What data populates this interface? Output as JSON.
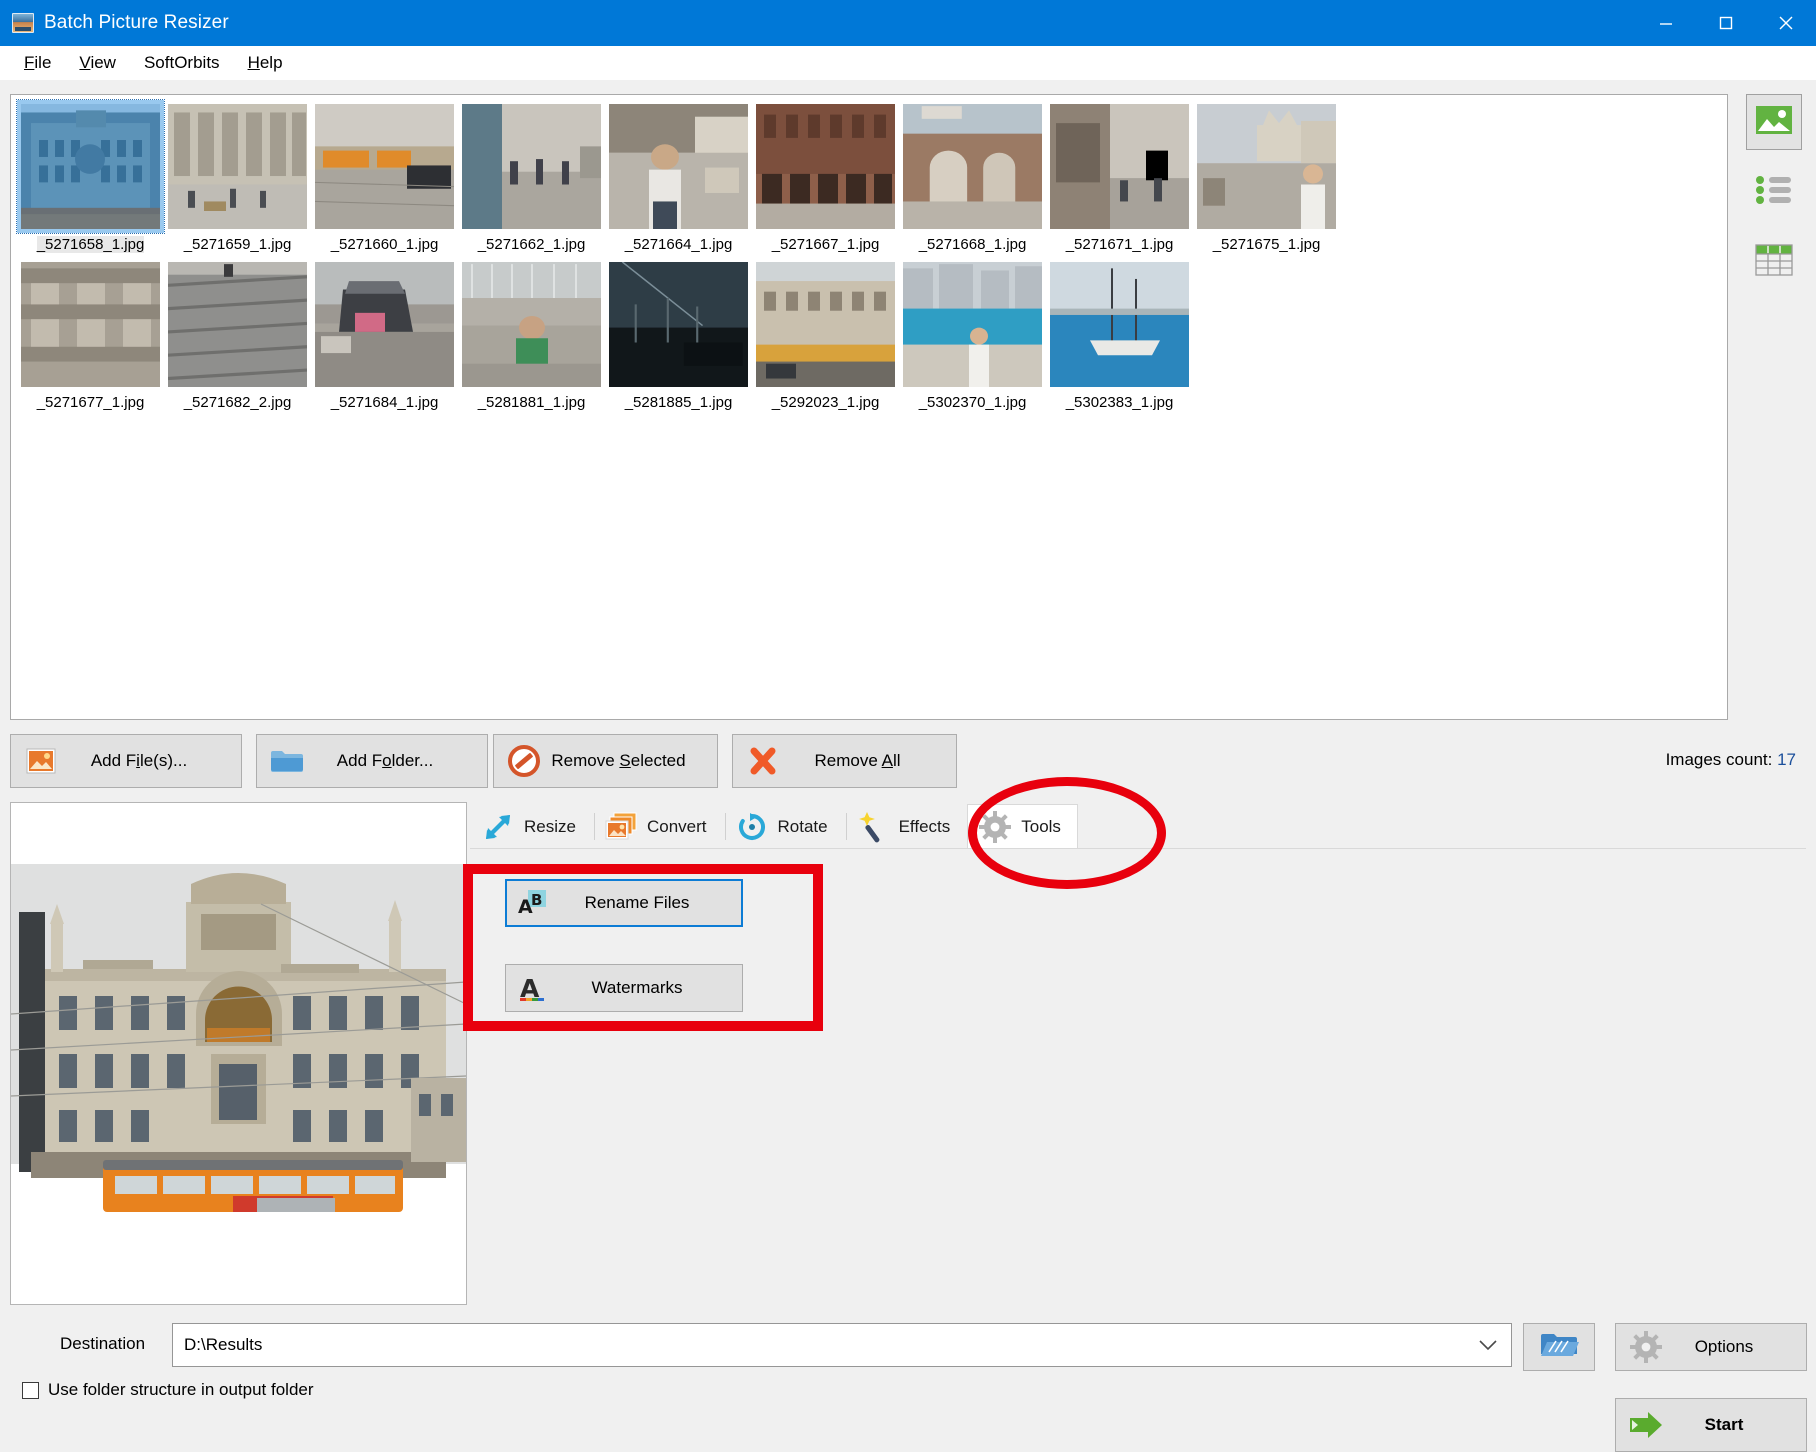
{
  "window": {
    "title": "Batch Picture Resizer",
    "app_icon": "picture-frame-icon",
    "controls": {
      "minimize": "minimize-icon",
      "maximize": "maximize-icon",
      "close": "close-icon"
    }
  },
  "menubar": {
    "items": [
      {
        "label": "File",
        "accel": "F"
      },
      {
        "label": "View",
        "accel": "V"
      },
      {
        "label": "SoftOrbits",
        "accel": ""
      },
      {
        "label": "Help",
        "accel": "H"
      }
    ]
  },
  "filelist": {
    "selected_index": 0,
    "rows": [
      [
        {
          "label": "_5271658_1.jpg",
          "kind": "building-blue"
        },
        {
          "label": "_5271659_1.jpg",
          "kind": "street-square"
        },
        {
          "label": "_5271660_1.jpg",
          "kind": "tram-street"
        },
        {
          "label": "_5271662_1.jpg",
          "kind": "plaza-walk"
        },
        {
          "label": "_5271664_1.jpg",
          "kind": "man-market"
        },
        {
          "label": "_5271667_1.jpg",
          "kind": "arcade-brick"
        },
        {
          "label": "_5271668_1.jpg",
          "kind": "arch-gate"
        },
        {
          "label": "_5271671_1.jpg",
          "kind": "galleria-street"
        },
        {
          "label": "_5271675_1.jpg",
          "kind": "duomo-man"
        }
      ],
      [
        {
          "label": "_5271677_1.jpg",
          "kind": "stone-carving"
        },
        {
          "label": "_5271682_2.jpg",
          "kind": "grey-steps"
        },
        {
          "label": "_5271684_1.jpg",
          "kind": "car-trunk"
        },
        {
          "label": "_5281881_1.jpg",
          "kind": "marina-man"
        },
        {
          "label": "_5281885_1.jpg",
          "kind": "harbour-dusk"
        },
        {
          "label": "_5292023_1.jpg",
          "kind": "seaside-building"
        },
        {
          "label": "_5302370_1.jpg",
          "kind": "woman-harbour"
        },
        {
          "label": "_5302383_1.jpg",
          "kind": "sailboat"
        }
      ]
    ]
  },
  "viewmodes": [
    {
      "name": "thumbnail-view",
      "icon": "picture-icon",
      "active": true
    },
    {
      "name": "list-view",
      "icon": "list-icon",
      "active": false
    },
    {
      "name": "details-view",
      "icon": "table-icon",
      "active": false
    }
  ],
  "actions": {
    "add_files": {
      "label": "Add File(s)...",
      "accel": "i",
      "icon": "picture-add-icon"
    },
    "add_folder": {
      "label": "Add Folder...",
      "accel": "o",
      "icon": "folder-icon"
    },
    "remove_selected": {
      "label": "Remove Selected",
      "accel": "S",
      "icon": "no-entry-icon"
    },
    "remove_all": {
      "label": "Remove All",
      "accel": "A",
      "icon": "red-cross-icon"
    },
    "images_count_label": "Images count:",
    "images_count_value": "17"
  },
  "tabs": [
    {
      "label": "Resize",
      "icon": "resize-arrow-icon",
      "active": false
    },
    {
      "label": "Convert",
      "icon": "convert-images-icon",
      "active": false
    },
    {
      "label": "Rotate",
      "icon": "rotate-icon",
      "active": false
    },
    {
      "label": "Effects",
      "icon": "magic-wand-icon",
      "active": false
    },
    {
      "label": "Tools",
      "icon": "gear-icon",
      "active": true
    }
  ],
  "tools_panel": {
    "rename_files": {
      "label": "Rename Files",
      "icon": "ab-rename-icon",
      "focused": true
    },
    "watermarks": {
      "label": "Watermarks",
      "icon": "letter-a-icon",
      "focused": false
    }
  },
  "bottom": {
    "destination_label": "Destination",
    "destination_value": "D:\\Results",
    "browse_icon": "open-folder-icon",
    "use_folder_structure": {
      "label": "Use folder structure in output folder",
      "checked": false
    },
    "options": {
      "label": "Options",
      "icon": "gear-icon"
    },
    "start": {
      "label": "Start",
      "icon": "green-arrow-icon"
    }
  },
  "preview": {
    "name": "selected-image-preview",
    "description": "Generali building with orange tram"
  },
  "annotations": {
    "color": "#e8000d",
    "ellipse_target": "Tools tab",
    "rect_target": "Tools panel buttons"
  }
}
